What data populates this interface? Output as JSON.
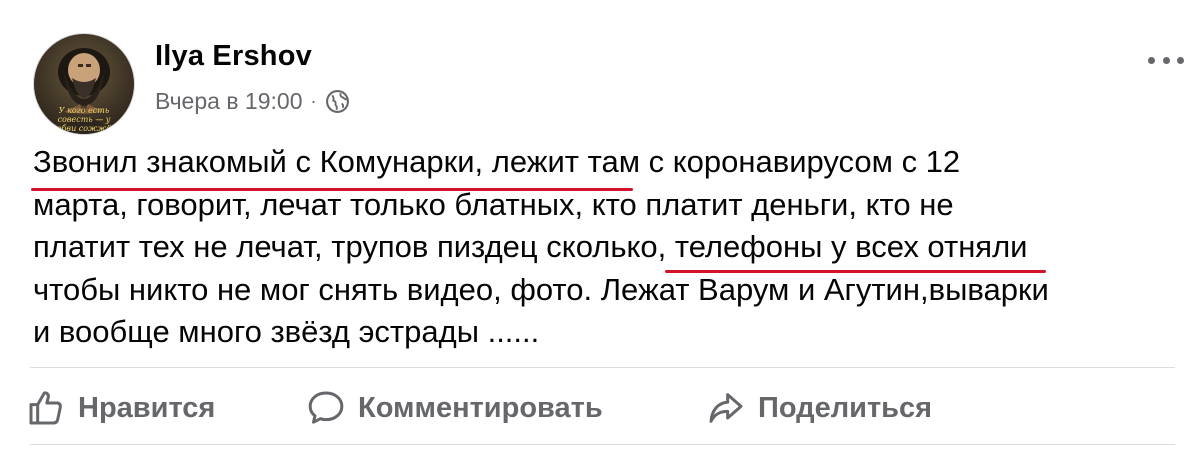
{
  "post": {
    "author": "Ilya Ershov",
    "timestamp": "Вчера в 19:00",
    "separator": "·",
    "privacy_icon": "globe-icon",
    "avatar_caption": "У кого есть совесть — у любви сожжёт",
    "text_lines": [
      {
        "before": "",
        "underlined": "Звонил знакомый с Комунарки",
        "after": ", лежит там с коронавирусом с 12"
      },
      {
        "before": "марта, говорит, лечат только блатных, кто платит деньги, кто не",
        "underlined": "",
        "after": ""
      },
      {
        "before": "платит тех не лечат, трупов пиздец сколько, ",
        "underlined": "телефоны у всех отняли",
        "after": ""
      },
      {
        "before": "чтобы никто не мог снять видео, фото. Лежат Варум и Агутин,выварки",
        "underlined": "",
        "after": ""
      },
      {
        "before": "и вообще много звёзд эстрады ......",
        "underlined": "",
        "after": ""
      }
    ],
    "underline_color": "#d3122b"
  },
  "actions": {
    "like_label": "Нравится",
    "comment_label": "Комментировать",
    "share_label": "Поделиться"
  },
  "colors": {
    "text": "#050505",
    "secondary": "#65676b",
    "divider": "#dadde1"
  }
}
